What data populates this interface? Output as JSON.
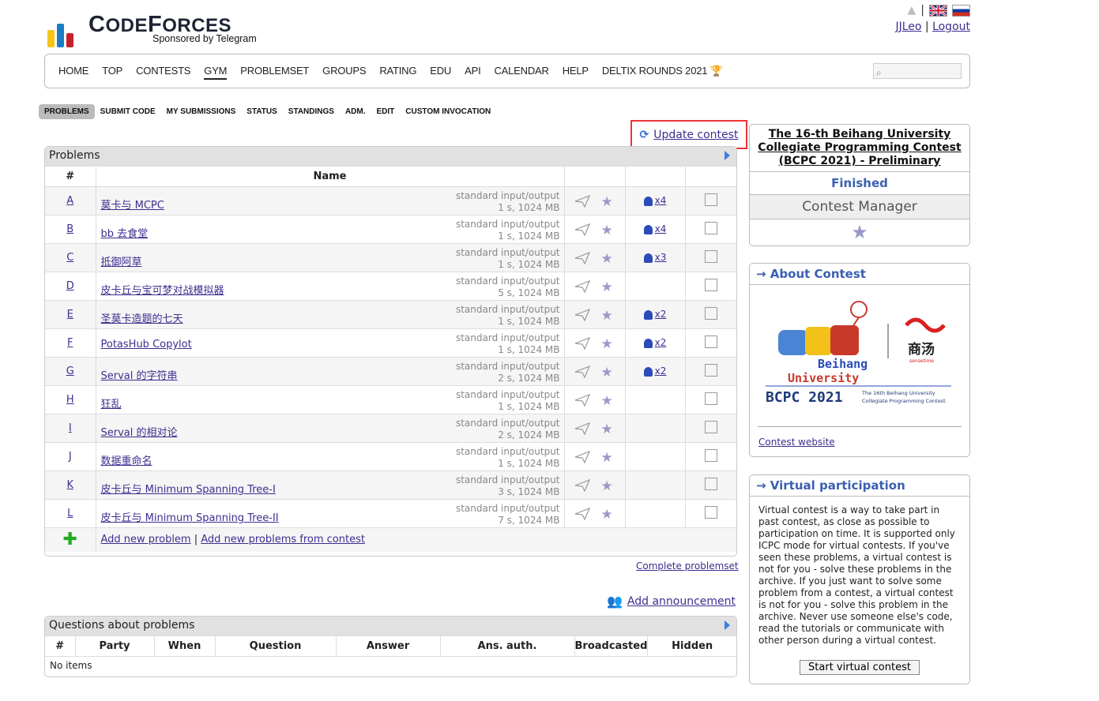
{
  "logo": {
    "word_a": "C",
    "word_b": "ODE",
    "word_c": "F",
    "word_d": "ORCES",
    "sponsor": "Sponsored by Telegram"
  },
  "user": {
    "name": "JJLeo",
    "sep": "|",
    "logout": "Logout"
  },
  "menu": [
    "HOME",
    "TOP",
    "CONTESTS",
    "GYM",
    "PROBLEMSET",
    "GROUPS",
    "RATING",
    "EDU",
    "API",
    "CALENDAR",
    "HELP",
    "DELTIX ROUNDS 2021"
  ],
  "submenu": [
    "PROBLEMS",
    "SUBMIT CODE",
    "MY SUBMISSIONS",
    "STATUS",
    "STANDINGS",
    "ADM.",
    "EDIT",
    "CUSTOM INVOCATION"
  ],
  "update_contest": "Update contest",
  "problems": {
    "caption": "Problems",
    "col_id": "#",
    "col_name": "Name",
    "rows": [
      {
        "id": "A",
        "name": "莫卡与 MCPC",
        "io": "standard input/output",
        "lim": "1 s, 1024 MB",
        "solved": "x4"
      },
      {
        "id": "B",
        "name": "bb 去食堂",
        "io": "standard input/output",
        "lim": "1 s, 1024 MB",
        "solved": "x4"
      },
      {
        "id": "C",
        "name": "抵御阿草",
        "io": "standard input/output",
        "lim": "1 s, 1024 MB",
        "solved": "x3"
      },
      {
        "id": "D",
        "name": "皮卡丘与宝可梦对战模拟器",
        "io": "standard input/output",
        "lim": "5 s, 1024 MB",
        "solved": ""
      },
      {
        "id": "E",
        "name": "圣莫卡造题的七天",
        "io": "standard input/output",
        "lim": "1 s, 1024 MB",
        "solved": "x2"
      },
      {
        "id": "F",
        "name": "PotasHub Copylot",
        "io": "standard input/output",
        "lim": "1 s, 1024 MB",
        "solved": "x2"
      },
      {
        "id": "G",
        "name": "Serval 的字符串",
        "io": "standard input/output",
        "lim": "2 s, 1024 MB",
        "solved": "x2"
      },
      {
        "id": "H",
        "name": "狂乱",
        "io": "standard input/output",
        "lim": "1 s, 1024 MB",
        "solved": ""
      },
      {
        "id": "I",
        "name": "Serval 的相对论",
        "io": "standard input/output",
        "lim": "2 s, 1024 MB",
        "solved": ""
      },
      {
        "id": "J",
        "name": "数据重命名",
        "io": "standard input/output",
        "lim": "1 s, 1024 MB",
        "solved": ""
      },
      {
        "id": "K",
        "name": "皮卡丘与 Minimum Spanning Tree-I",
        "io": "standard input/output",
        "lim": "3 s, 1024 MB",
        "solved": ""
      },
      {
        "id": "L",
        "name": "皮卡丘与 Minimum Spanning Tree-II",
        "io": "standard input/output",
        "lim": "7 s, 1024 MB",
        "solved": ""
      }
    ],
    "add_new": "Add new problem",
    "add_sep": "|",
    "add_from": "Add new problems from contest"
  },
  "complete_problemset": "Complete problemset",
  "add_announcement": "Add announcement",
  "questions": {
    "caption": "Questions about problems",
    "headers": [
      "#",
      "Party",
      "When",
      "Question",
      "Answer",
      "Ans. auth.",
      "Broadcasted",
      "Hidden"
    ],
    "empty": "No items"
  },
  "contest": {
    "title": "The 16-th Beihang University Collegiate Programming Contest (BCPC 2021) - Preliminary",
    "status": "Finished",
    "manager": "Contest Manager"
  },
  "about": {
    "title": "→ About Contest",
    "logo_l1": "Beihang",
    "logo_l2": "University",
    "logo_bcpc": "BCPC 2021",
    "logo_small1": "The 16th Beihang University",
    "logo_small2": "Collegiate Programming Contest",
    "logo_brand": "商汤",
    "logo_brand_sub": "sensetime",
    "website": "Contest website"
  },
  "virtual": {
    "title": "→ Virtual participation",
    "text": "Virtual contest is a way to take part in past contest, as close as possible to participation on time. It is supported only ICPC mode for virtual contests. If you've seen these problems, a virtual contest is not for you - solve these problems in the archive. If you just want to solve some problem from a contest, a virtual contest is not for you - solve this problem in the archive. Never use someone else's code, read the tutorials or communicate with other person during a virtual contest.",
    "button": "Start virtual contest"
  },
  "colors": {
    "accent": "#3b5fb0",
    "link": "#3b2f8f",
    "highlight": "#ee3333"
  }
}
